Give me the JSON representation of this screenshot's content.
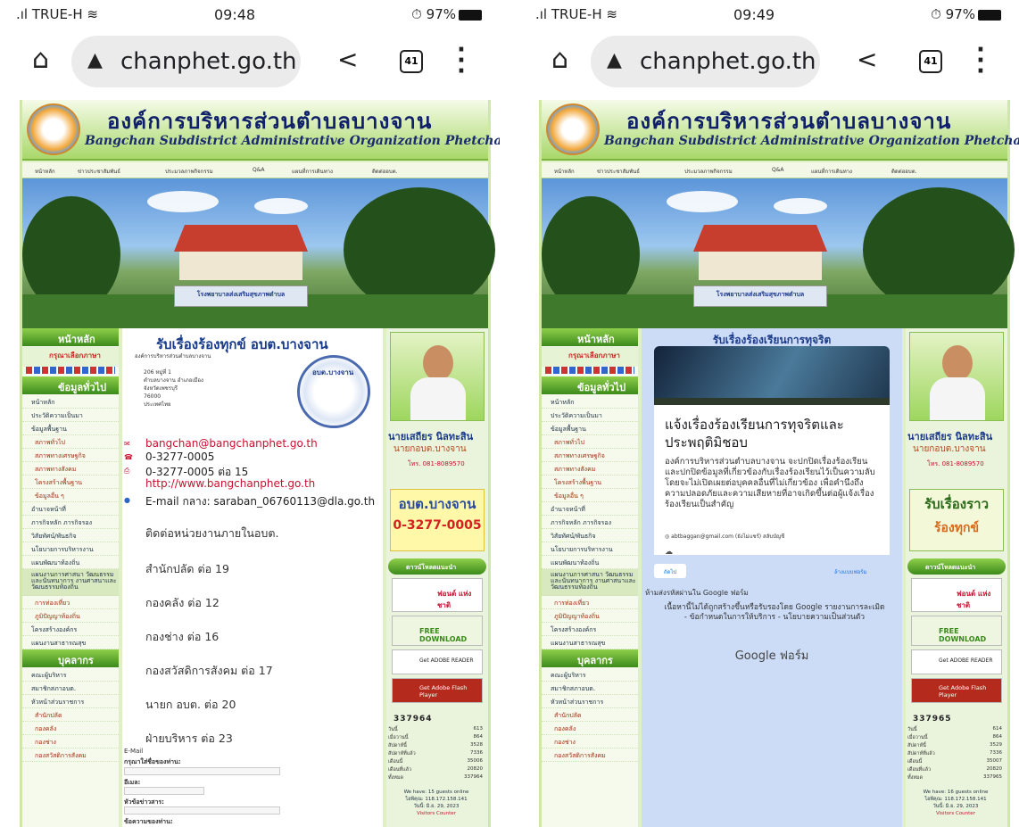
{
  "status_left": {
    "carrier": "TRUE-H",
    "time": "09:48",
    "battery": "97%"
  },
  "status_right": {
    "carrier": "TRUE-H",
    "time": "09:49",
    "battery": "97%"
  },
  "browser": {
    "url": "chanphet.go.th",
    "tab_count": "41"
  },
  "site": {
    "title_th": "องค์การบริหารส่วนตำบลบางจาน",
    "title_en": "Bangchan Subdistrict Administrative Organization Phetchaburi",
    "nav": [
      "หน้าหลัก",
      "ข่าวประชาสัมพันธ์",
      "ประมวลภาพกิจกรรม",
      "Q&A",
      "แผนที่การเดินทาง",
      "ติดต่ออบต."
    ],
    "photo_sign": "โรงพยาบาลส่งเสริมสุขภาพตำบล",
    "left": {
      "home": "หน้าหลัก",
      "lang": "กรุณาเลือกภาษา",
      "info_head": "ข้อมูลทั่วไป",
      "menu": [
        "หน้าหลัก",
        "ประวัติความเป็นมา",
        "ข้อมูลพื้นฐาน",
        "สภาพทั่วไป",
        "สภาพทางเศรษฐกิจ",
        "สภาพทางสังคม",
        "โครงสร้างพื้นฐาน",
        "ข้อมูลอื่น ๆ",
        "อำนาจหน้าที่",
        "ภารกิจหลัก ภารกิจรอง",
        "วิสัยทัศน์/พันธกิจ",
        "นโยบายการบริหารงาน",
        "แผนพัฒนาท้องถิ่น",
        "แผนงานการศาสนา วัฒนธรรมและนันทนาการ งานศาสนาและวัฒนธรรมท้องถิ่น",
        "การท่องเที่ยว",
        "ภูมิปัญญาท้องถิ่น",
        "โครงสร้างองค์กร",
        "แผนงานสาธารณสุข"
      ],
      "people_head": "บุคลากร",
      "people": [
        "คณะผู้บริหาร",
        "สมาชิกสภาอบต.",
        "หัวหน้าส่วนราชการ",
        "สำนักปลัด",
        "กองคลัง",
        "กองช่าง",
        "กองสวัสดิการสังคม"
      ]
    },
    "right": {
      "name": "นายเสถียร นิลทะสิน",
      "role": "นายกอบต.บางจาน",
      "tel": "โทร. 081-8089570",
      "ad_top": "อบต.บางจาน",
      "ad_phone": "0-3277-0005",
      "ad2_top": "รับเรื่องราว",
      "ad2_bottom": "ร้องทุกข์",
      "download_head": "ดาวน์โหลดแนะนำ",
      "dl_font": "ฟอนต์ แห่งชาติ",
      "dl_ict": "FREE DOWNLOAD",
      "dl_reader": "Get ADOBE READER",
      "dl_flash": "Get Adobe Flash Player",
      "stat_labels": [
        "วันนี้",
        "เมื่อวานนี้",
        "สัปดาห์นี้",
        "สัปดาห์ที่แล้ว",
        "เดือนนี้",
        "เดือนที่แล้ว",
        "ทั้งหมด"
      ],
      "online_guests_left": "We have: 15 guests online",
      "online_guests_right": "We have: 16 guests online",
      "ip": "ไอพีคุณ: 118.172.158.141",
      "date": "วันนี้: มิ.ย. 29, 2023",
      "visitors": "Visitors Counter"
    }
  },
  "left_page": {
    "content_title": "รับเรื่องร้องทุกข์ อบต.บางจาน",
    "org_small": "องค์การบริหารส่วนตำบลบางจาน",
    "address": [
      "206 หมู่ที่ 1",
      "ตำบลบางจาน อำเภอเมือง",
      "จังหวัดเพชรบุรี",
      "76000",
      "ประเทศไทย"
    ],
    "seal_text": "อบต.บางจาน",
    "email": "bangchan@bangchanphet.go.th",
    "phone1": "0-3277-0005",
    "phone2": "0-3277-0005 ต่อ 15",
    "web": "http://www.bangchanphet.go.th",
    "email_central": "E-mail กลาง: saraban_06760113@dla.go.th",
    "internal_head": "ติดต่อหน่วยงานภายในอบต.",
    "extensions": [
      "สำนักปลัด ต่อ 19",
      "กองคลัง ต่อ 12",
      "กองช่าง ต่อ 16",
      "กองสวัสดิการสังคม ต่อ 17",
      "นายก อบต. ต่อ 20",
      "ฝ่ายบริหาร ต่อ 23"
    ],
    "form_email_label": "E-Mail",
    "form_name_label": "กรุณาใส่ชื่อของท่าน:",
    "form_mail_label": "อีเมล:",
    "form_subject_label": "หัวข้อข่าวสาร:",
    "form_message_label": "ข้อความของท่าน:",
    "counter": "337964",
    "stats": [
      "613",
      "864",
      "3528",
      "7336",
      "35006",
      "20820",
      "337964"
    ]
  },
  "right_page": {
    "content_title": "รับเรื่องร้องเรียนการทุจริต",
    "form_title": "แจ้งเรื่องร้องเรียนการทุจริตและประพฤติมิชอบ",
    "form_desc": "องค์การบริหารส่วนตำบลบางจาน จะปกปิดเรื่องร้องเรียนและปกปิดข้อมูลที่เกี่ยวข้องกับเรื่องร้องเรียนไว้เป็นความลับโดยจะไม่เปิดเผยต่อบุคคลอื่นที่ไม่เกี่ยวข้อง เพื่อคำนึงถึงความปลอดภัยและความเสียหายที่อาจเกิดขึ้นต่อผู้แจ้งเรื่องร้องเรียนเป็นสำคัญ",
    "account": "abtbaggan@gmail.com (ยังไม่แชร์) สลับบัญชี",
    "next": "ถัดไป",
    "clear": "ล้างแบบฟอร์ม",
    "never": "ห้ามส่งรหัสผ่านใน Google ฟอร์ม",
    "footer": "เนื้อหานี้ไม่ได้ถูกสร้างขึ้นหรือรับรองโดย Google รายงานการละเมิด - ข้อกำหนดในการให้บริการ - นโยบายความเป็นส่วนตัว",
    "brand": "Google ฟอร์ม",
    "counter": "337965",
    "stats": [
      "614",
      "864",
      "3529",
      "7336",
      "35007",
      "20820",
      "337965"
    ]
  }
}
